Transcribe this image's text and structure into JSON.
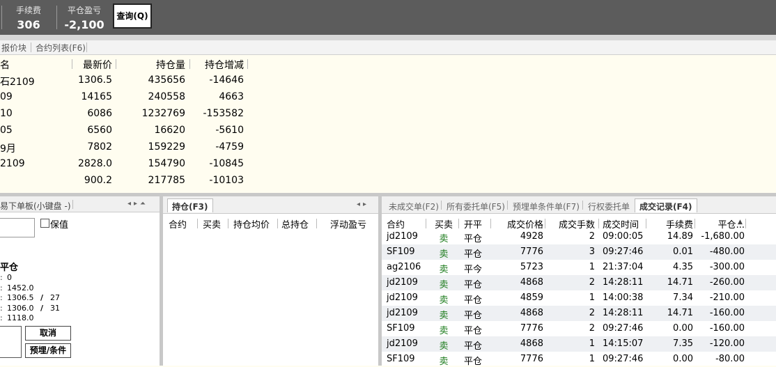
{
  "topbar": {
    "fee": {
      "label": "手续费",
      "value": "306"
    },
    "close_pnl": {
      "label": "平仓盈亏",
      "value": "-2,100"
    },
    "query_label": "查询(Q)"
  },
  "tabs": [
    "报价块",
    "合约列表(F6)"
  ],
  "quote": {
    "headers": [
      "名",
      "最新价",
      "持仓量",
      "持仓增减"
    ],
    "rows": [
      [
        "石2109",
        "1306.5",
        "435656",
        "-14646"
      ],
      [
        "09",
        "14165",
        "240558",
        "4663"
      ],
      [
        "10",
        "6086",
        "1232769",
        "-153582"
      ],
      [
        "05",
        "6560",
        "16620",
        "-5610"
      ],
      [
        "9月",
        "7802",
        "159229",
        "-4759"
      ],
      [
        "2109",
        "2828.0",
        "154790",
        "-10845"
      ],
      [
        "",
        "900.2",
        "217785",
        "-10103"
      ]
    ]
  },
  "order_panel": {
    "title": "易下单板(小键盘 -)",
    "hedge_label": "保值",
    "close_label": "平仓",
    "lines": [
      {
        "value": "0",
        "right": ""
      },
      {
        "value": "1452.0",
        "right": ""
      },
      {
        "value": "1306.5",
        "right": "27"
      },
      {
        "value": "1306.0",
        "right": "31"
      },
      {
        "value": "1118.0",
        "right": ""
      }
    ],
    "cancel_label": "取消",
    "preset_label": "预埋/条件"
  },
  "position_panel": {
    "tab": "持仓(F3)",
    "headers": [
      "合约",
      "买卖",
      "持仓均价",
      "总持仓",
      "浮动盈亏"
    ]
  },
  "trade_panel": {
    "tabs": [
      "未成交单(F2)",
      "所有委托单(F5)",
      "预埋单条件单(F7)",
      "行权委托单",
      "成交记录(F4)"
    ],
    "headers": [
      "合约",
      "买卖",
      "开平",
      "成交价格",
      "成交手数",
      "成交时间",
      "手续费",
      "平仓..."
    ],
    "rows": [
      [
        "jd2109",
        "卖",
        "平仓",
        "4928",
        "2",
        "09:00:05",
        "14.89",
        "-1,680.00"
      ],
      [
        "SF109",
        "卖",
        "平仓",
        "7776",
        "3",
        "09:27:46",
        "0.01",
        "-480.00"
      ],
      [
        "ag2106",
        "卖",
        "平今",
        "5723",
        "1",
        "21:37:04",
        "4.35",
        "-300.00"
      ],
      [
        "jd2109",
        "卖",
        "平仓",
        "4868",
        "2",
        "14:28:11",
        "14.71",
        "-260.00"
      ],
      [
        "jd2109",
        "卖",
        "平仓",
        "4859",
        "1",
        "14:00:38",
        "7.34",
        "-210.00"
      ],
      [
        "jd2109",
        "卖",
        "平仓",
        "4868",
        "2",
        "14:28:11",
        "14.71",
        "-160.00"
      ],
      [
        "SF109",
        "卖",
        "平仓",
        "7776",
        "2",
        "09:27:46",
        "0.00",
        "-160.00"
      ],
      [
        "jd2109",
        "卖",
        "平仓",
        "4868",
        "1",
        "14:15:07",
        "7.35",
        "-120.00"
      ],
      [
        "SF109",
        "卖",
        "平仓",
        "7776",
        "1",
        "09:27:46",
        "0.00",
        "-80.00"
      ]
    ]
  }
}
